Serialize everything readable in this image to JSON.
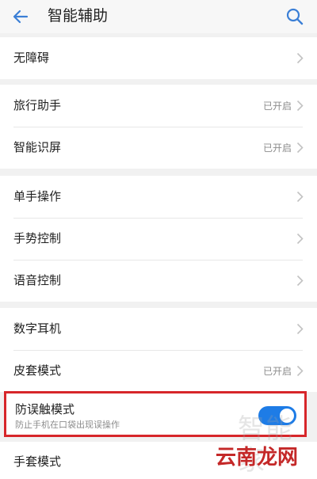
{
  "header": {
    "title": "智能辅助",
    "back_icon": "arrow-left-icon",
    "search_icon": "search-icon"
  },
  "groups": [
    {
      "items": [
        {
          "label": "无障碍",
          "status": ""
        }
      ]
    },
    {
      "items": [
        {
          "label": "旅行助手",
          "status": "已开启"
        },
        {
          "label": "智能识屏",
          "status": "已开启"
        }
      ]
    },
    {
      "items": [
        {
          "label": "单手操作",
          "status": ""
        },
        {
          "label": "手势控制",
          "status": ""
        },
        {
          "label": "语音控制",
          "status": ""
        }
      ]
    },
    {
      "items": [
        {
          "label": "数字耳机",
          "status": ""
        },
        {
          "label": "皮套模式",
          "status": "已开启"
        }
      ]
    }
  ],
  "highlighted_item": {
    "title": "防误触模式",
    "subtitle": "防止手机在口袋出现误操作",
    "toggle_on": true,
    "border_color": "#d7262a",
    "toggle_color": "#1e7ce6"
  },
  "last_item": {
    "label": "手套模式"
  },
  "watermark": {
    "faint_text": "智能家",
    "main_text": "云南龙网"
  }
}
